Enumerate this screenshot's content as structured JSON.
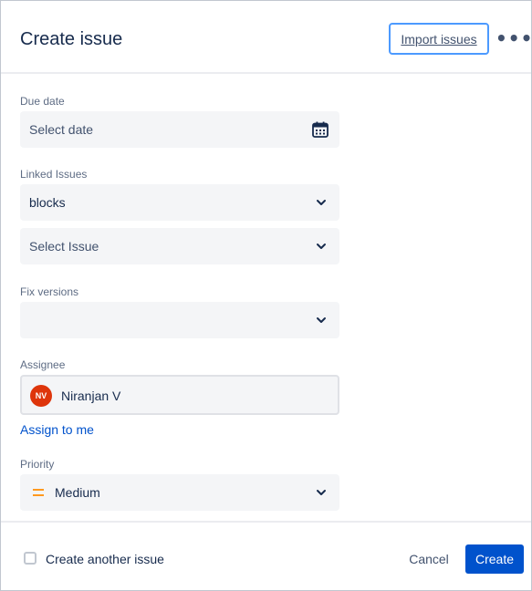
{
  "dialog": {
    "title": "Create issue",
    "import_label": "Import issues",
    "more_label": "•••"
  },
  "fields": {
    "due_date": {
      "label": "Due date",
      "placeholder": "Select date",
      "icon": "calendar-icon"
    },
    "linked_issues": {
      "label": "Linked Issues",
      "relation_value": "blocks",
      "issue_placeholder": "Select Issue"
    },
    "fix_versions": {
      "label": "Fix versions",
      "value": ""
    },
    "assignee": {
      "label": "Assignee",
      "avatar_initials": "NV",
      "avatar_color": "#de350b",
      "name": "Niranjan V",
      "assign_to_me": "Assign to me"
    },
    "priority": {
      "label": "Priority",
      "value": "Medium",
      "icon_color": "#ff991f"
    }
  },
  "footer": {
    "create_another_label": "Create another issue",
    "create_another_checked": false,
    "cancel_label": "Cancel",
    "create_label": "Create"
  },
  "colors": {
    "primary": "#0052cc",
    "field_bg": "#f4f5f7",
    "focus_border": "#4c9aff"
  }
}
